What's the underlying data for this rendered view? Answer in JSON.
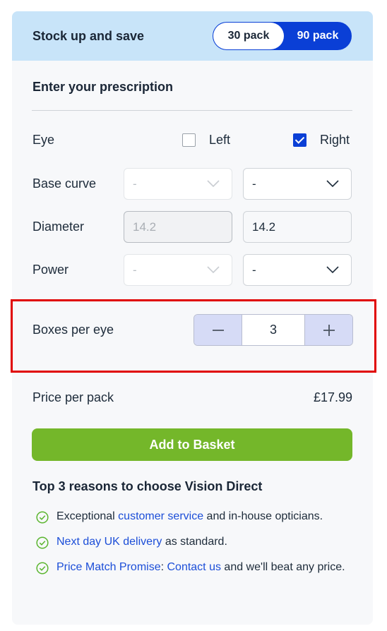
{
  "banner": {
    "title": "Stock up and save",
    "pack_30": "30 pack",
    "pack_90": "90 pack"
  },
  "prescription": {
    "title": "Enter your prescription",
    "eye_label": "Eye",
    "left_label": "Left",
    "right_label": "Right",
    "left_checked": false,
    "right_checked": true,
    "base_curve_label": "Base curve",
    "base_curve_left": "-",
    "base_curve_right": "-",
    "diameter_label": "Diameter",
    "diameter_left": "14.2",
    "diameter_right": "14.2",
    "power_label": "Power",
    "power_left": "-",
    "power_right": "-"
  },
  "boxes": {
    "label": "Boxes per eye",
    "value": "3",
    "minus": "−",
    "plus": "+"
  },
  "price": {
    "label": "Price per pack",
    "value": "£17.99"
  },
  "basket_button": "Add to Basket",
  "reasons": {
    "title": "Top 3 reasons to choose Vision Direct",
    "r1_pre": "Exceptional ",
    "r1_link": "customer service",
    "r1_post": " and in-house opticians.",
    "r2_link": "Next day UK delivery",
    "r2_post": " as standard.",
    "r3_link1": "Price Match Promise",
    "r3_sep": ": ",
    "r3_link2": "Contact us",
    "r3_post": " and we'll beat any price."
  },
  "colors": {
    "accent_blue": "#0a3fd6",
    "basket_green": "#74b72a",
    "banner_bg": "#c8e4f9",
    "highlight_red": "#e00000",
    "tick_green": "#5bb52f"
  },
  "icons": {
    "check": "checkmark-icon",
    "chevron": "chevron-down-icon",
    "tick": "check-circle-icon"
  }
}
